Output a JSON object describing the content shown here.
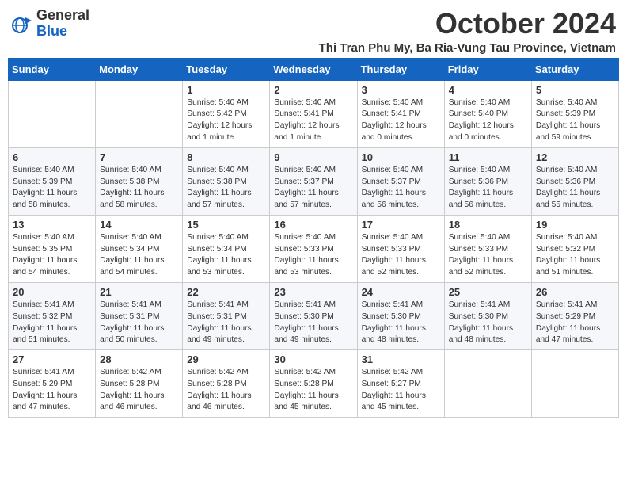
{
  "logo": {
    "general": "General",
    "blue": "Blue"
  },
  "title": "October 2024",
  "subtitle": "Thi Tran Phu My, Ba Ria-Vung Tau Province, Vietnam",
  "days_of_week": [
    "Sunday",
    "Monday",
    "Tuesday",
    "Wednesday",
    "Thursday",
    "Friday",
    "Saturday"
  ],
  "weeks": [
    [
      {
        "day": null,
        "content": ""
      },
      {
        "day": null,
        "content": ""
      },
      {
        "day": "1",
        "content": "Sunrise: 5:40 AM\nSunset: 5:42 PM\nDaylight: 12 hours and 1 minute."
      },
      {
        "day": "2",
        "content": "Sunrise: 5:40 AM\nSunset: 5:41 PM\nDaylight: 12 hours and 1 minute."
      },
      {
        "day": "3",
        "content": "Sunrise: 5:40 AM\nSunset: 5:41 PM\nDaylight: 12 hours and 0 minutes."
      },
      {
        "day": "4",
        "content": "Sunrise: 5:40 AM\nSunset: 5:40 PM\nDaylight: 12 hours and 0 minutes."
      },
      {
        "day": "5",
        "content": "Sunrise: 5:40 AM\nSunset: 5:39 PM\nDaylight: 11 hours and 59 minutes."
      }
    ],
    [
      {
        "day": "6",
        "content": "Sunrise: 5:40 AM\nSunset: 5:39 PM\nDaylight: 11 hours and 58 minutes."
      },
      {
        "day": "7",
        "content": "Sunrise: 5:40 AM\nSunset: 5:38 PM\nDaylight: 11 hours and 58 minutes."
      },
      {
        "day": "8",
        "content": "Sunrise: 5:40 AM\nSunset: 5:38 PM\nDaylight: 11 hours and 57 minutes."
      },
      {
        "day": "9",
        "content": "Sunrise: 5:40 AM\nSunset: 5:37 PM\nDaylight: 11 hours and 57 minutes."
      },
      {
        "day": "10",
        "content": "Sunrise: 5:40 AM\nSunset: 5:37 PM\nDaylight: 11 hours and 56 minutes."
      },
      {
        "day": "11",
        "content": "Sunrise: 5:40 AM\nSunset: 5:36 PM\nDaylight: 11 hours and 56 minutes."
      },
      {
        "day": "12",
        "content": "Sunrise: 5:40 AM\nSunset: 5:36 PM\nDaylight: 11 hours and 55 minutes."
      }
    ],
    [
      {
        "day": "13",
        "content": "Sunrise: 5:40 AM\nSunset: 5:35 PM\nDaylight: 11 hours and 54 minutes."
      },
      {
        "day": "14",
        "content": "Sunrise: 5:40 AM\nSunset: 5:34 PM\nDaylight: 11 hours and 54 minutes."
      },
      {
        "day": "15",
        "content": "Sunrise: 5:40 AM\nSunset: 5:34 PM\nDaylight: 11 hours and 53 minutes."
      },
      {
        "day": "16",
        "content": "Sunrise: 5:40 AM\nSunset: 5:33 PM\nDaylight: 11 hours and 53 minutes."
      },
      {
        "day": "17",
        "content": "Sunrise: 5:40 AM\nSunset: 5:33 PM\nDaylight: 11 hours and 52 minutes."
      },
      {
        "day": "18",
        "content": "Sunrise: 5:40 AM\nSunset: 5:33 PM\nDaylight: 11 hours and 52 minutes."
      },
      {
        "day": "19",
        "content": "Sunrise: 5:40 AM\nSunset: 5:32 PM\nDaylight: 11 hours and 51 minutes."
      }
    ],
    [
      {
        "day": "20",
        "content": "Sunrise: 5:41 AM\nSunset: 5:32 PM\nDaylight: 11 hours and 51 minutes."
      },
      {
        "day": "21",
        "content": "Sunrise: 5:41 AM\nSunset: 5:31 PM\nDaylight: 11 hours and 50 minutes."
      },
      {
        "day": "22",
        "content": "Sunrise: 5:41 AM\nSunset: 5:31 PM\nDaylight: 11 hours and 49 minutes."
      },
      {
        "day": "23",
        "content": "Sunrise: 5:41 AM\nSunset: 5:30 PM\nDaylight: 11 hours and 49 minutes."
      },
      {
        "day": "24",
        "content": "Sunrise: 5:41 AM\nSunset: 5:30 PM\nDaylight: 11 hours and 48 minutes."
      },
      {
        "day": "25",
        "content": "Sunrise: 5:41 AM\nSunset: 5:30 PM\nDaylight: 11 hours and 48 minutes."
      },
      {
        "day": "26",
        "content": "Sunrise: 5:41 AM\nSunset: 5:29 PM\nDaylight: 11 hours and 47 minutes."
      }
    ],
    [
      {
        "day": "27",
        "content": "Sunrise: 5:41 AM\nSunset: 5:29 PM\nDaylight: 11 hours and 47 minutes."
      },
      {
        "day": "28",
        "content": "Sunrise: 5:42 AM\nSunset: 5:28 PM\nDaylight: 11 hours and 46 minutes."
      },
      {
        "day": "29",
        "content": "Sunrise: 5:42 AM\nSunset: 5:28 PM\nDaylight: 11 hours and 46 minutes."
      },
      {
        "day": "30",
        "content": "Sunrise: 5:42 AM\nSunset: 5:28 PM\nDaylight: 11 hours and 45 minutes."
      },
      {
        "day": "31",
        "content": "Sunrise: 5:42 AM\nSunset: 5:27 PM\nDaylight: 11 hours and 45 minutes."
      },
      {
        "day": null,
        "content": ""
      },
      {
        "day": null,
        "content": ""
      }
    ]
  ]
}
